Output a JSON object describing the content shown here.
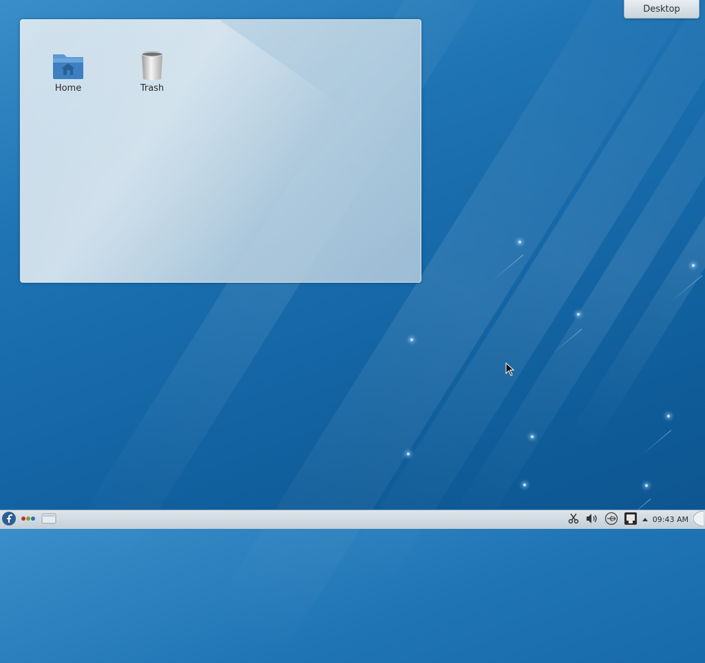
{
  "desktop": {
    "icons": [
      {
        "label": "Home",
        "icon": "home-folder-icon"
      },
      {
        "label": "Trash",
        "icon": "trash-icon"
      }
    ]
  },
  "toolbox": {
    "label": "Desktop"
  },
  "panel": {
    "launcher_icon": "fedora-logo-icon",
    "pager_icon": "activity-dots-icon",
    "taskbar_icon": "show-desktop-icon",
    "tray": [
      {
        "icon": "klipper-scissors-icon"
      },
      {
        "icon": "volume-icon"
      },
      {
        "icon": "usb-device-notifier-icon"
      },
      {
        "icon": "network-icon"
      },
      {
        "icon": "expand-tray-arrow-icon"
      }
    ],
    "clock": "09:43 AM"
  },
  "colors": {
    "wallpaper": "#1668a8",
    "panel": "#c3ced7",
    "folder_blue": "#3e7fc1"
  }
}
